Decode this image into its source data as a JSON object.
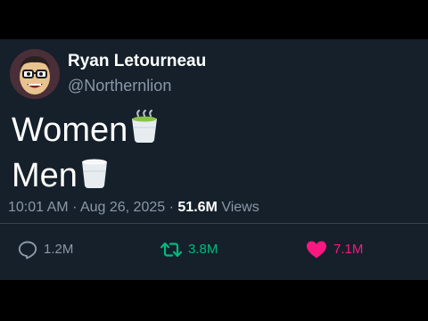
{
  "user": {
    "display_name": "Ryan Letourneau",
    "handle": "@Northernlion"
  },
  "tweet": {
    "line1": "Women",
    "line1_emoji": "matcha-cup-icon",
    "line2": "Men",
    "line2_emoji": "milk-cup-icon",
    "time": "10:01 AM",
    "separator": "·",
    "date": "Aug 26, 2025",
    "views_count": "51.6M",
    "views_label": "Views"
  },
  "actions": {
    "replies": "1.2M",
    "reposts": "3.8M",
    "likes": "7.1M"
  },
  "colors": {
    "background": "#15202b",
    "text_secondary": "#8b98a5",
    "repost_active": "#00ba7c",
    "like_active": "#f91880"
  }
}
